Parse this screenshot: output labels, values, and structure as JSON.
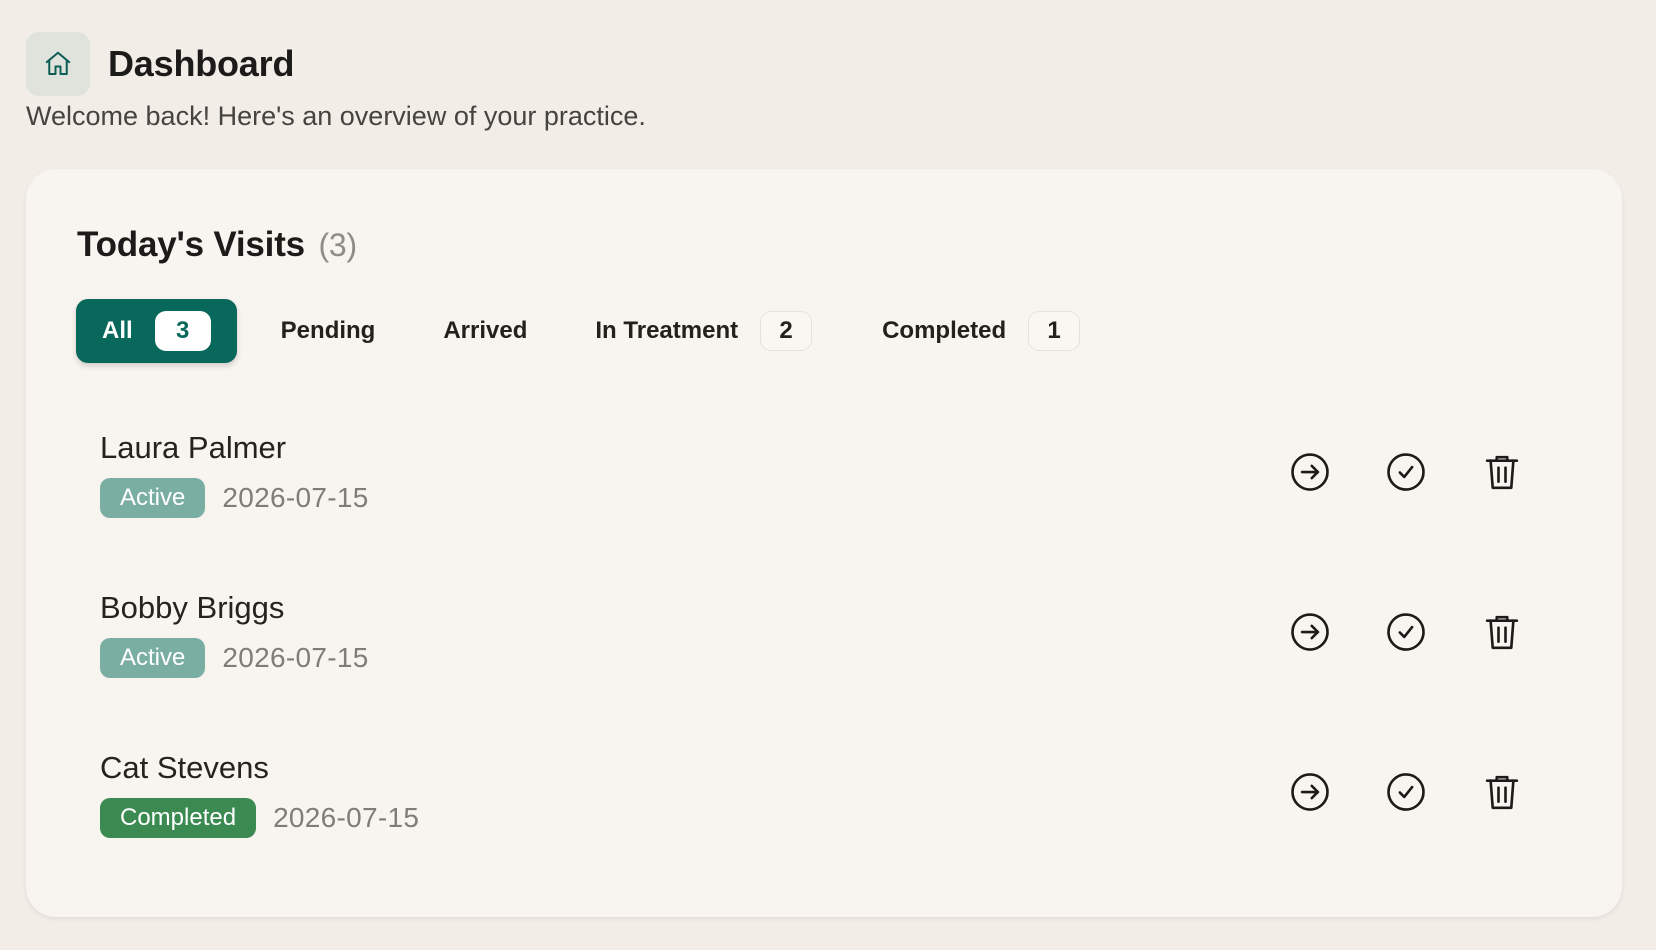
{
  "header": {
    "icon": "home-icon",
    "title": "Dashboard",
    "subtitle": "Welcome back! Here's an overview of your practice."
  },
  "visits_card": {
    "title": "Today's Visits",
    "count": "(3)",
    "tabs": [
      {
        "label": "All",
        "count": "3",
        "active": true
      },
      {
        "label": "Pending"
      },
      {
        "label": "Arrived"
      },
      {
        "label": "In Treatment",
        "count": "2"
      },
      {
        "label": "Completed",
        "count": "1"
      }
    ],
    "visits": [
      {
        "name": "Laura Palmer",
        "status": "Active",
        "date": "2026-07-15"
      },
      {
        "name": "Bobby Briggs",
        "status": "Active",
        "date": "2026-07-15"
      },
      {
        "name": "Cat Stevens",
        "status": "Completed",
        "date": "2026-07-15"
      }
    ],
    "row_actions": [
      "arrow-right-circle-icon",
      "check-circle-icon",
      "trash-icon"
    ]
  },
  "colors": {
    "background": "#f2ede7",
    "card": "#f8f4ef",
    "accent": "#08685c",
    "status_active": "#7aaea3",
    "status_completed": "#3a8a52"
  }
}
